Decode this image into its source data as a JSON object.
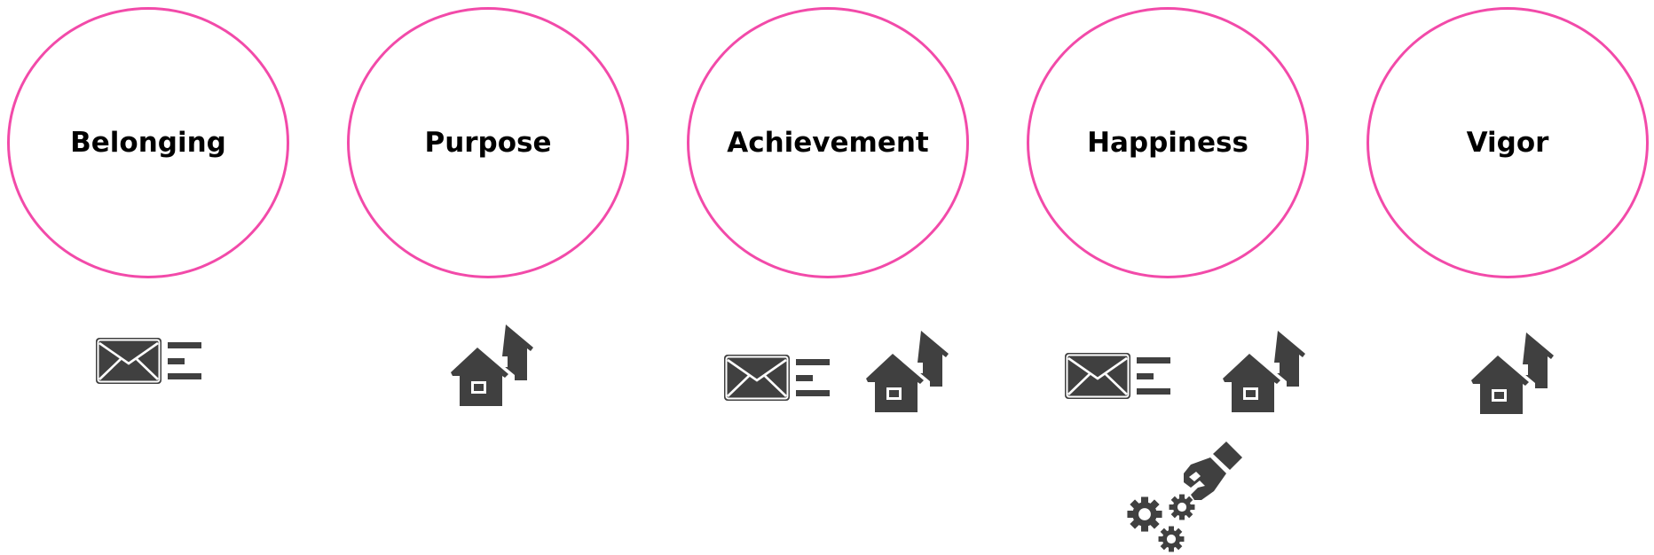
{
  "categories": [
    {
      "label": "Belonging",
      "icons": [
        "mail-list-icon"
      ]
    },
    {
      "label": "Purpose",
      "icons": [
        "houses-icon"
      ]
    },
    {
      "label": "Achievement",
      "icons": [
        "mail-list-icon",
        "houses-icon"
      ]
    },
    {
      "label": "Happiness",
      "icons": [
        "mail-list-icon",
        "houses-icon",
        "hand-gears-icon"
      ]
    },
    {
      "label": "Vigor",
      "icons": [
        "houses-icon"
      ]
    }
  ],
  "colors": {
    "circle_border": "#f24aa9",
    "icon_fill": "#404040",
    "text": "#000000"
  }
}
